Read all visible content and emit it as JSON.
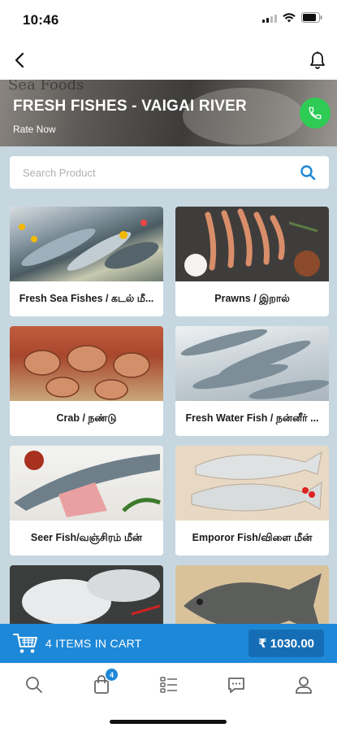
{
  "status_bar": {
    "time": "10:46"
  },
  "hero": {
    "deco_text": "Sea Foods",
    "title": "FRESH FISHES - VAIGAI RIVER",
    "subtitle": "Rate Now"
  },
  "search": {
    "placeholder": "Search Product"
  },
  "categories": [
    {
      "label": "Fresh Sea Fishes / கடல் மீ...",
      "image": "sea-fishes-photo"
    },
    {
      "label": "Prawns / இறால்",
      "image": "prawns-photo"
    },
    {
      "label": "Crab / நண்டு",
      "image": "crab-photo"
    },
    {
      "label": "Fresh Water Fish / நன்னீர் ...",
      "image": "fresh-water-fish-photo"
    },
    {
      "label": "Seer Fish/வஞ்சிரம் மீன்",
      "image": "seer-fish-photo"
    },
    {
      "label": "Emporor Fish/விளை மீன்",
      "image": "emperor-fish-photo"
    },
    {
      "label": "",
      "image": "pomfret-photo"
    },
    {
      "label": "",
      "image": "black-pomfret-photo"
    }
  ],
  "cart": {
    "items_text": "4 ITEMS  IN CART",
    "total": "₹ 1030.00"
  },
  "tabs": {
    "cart_badge": "4",
    "items": [
      "search-icon",
      "shopping-bag-icon",
      "list-icon",
      "chat-icon",
      "profile-icon"
    ]
  },
  "colors": {
    "accent": "#1e88d8",
    "call": "#2ecc55",
    "content_bg": "#c6d7e0"
  }
}
